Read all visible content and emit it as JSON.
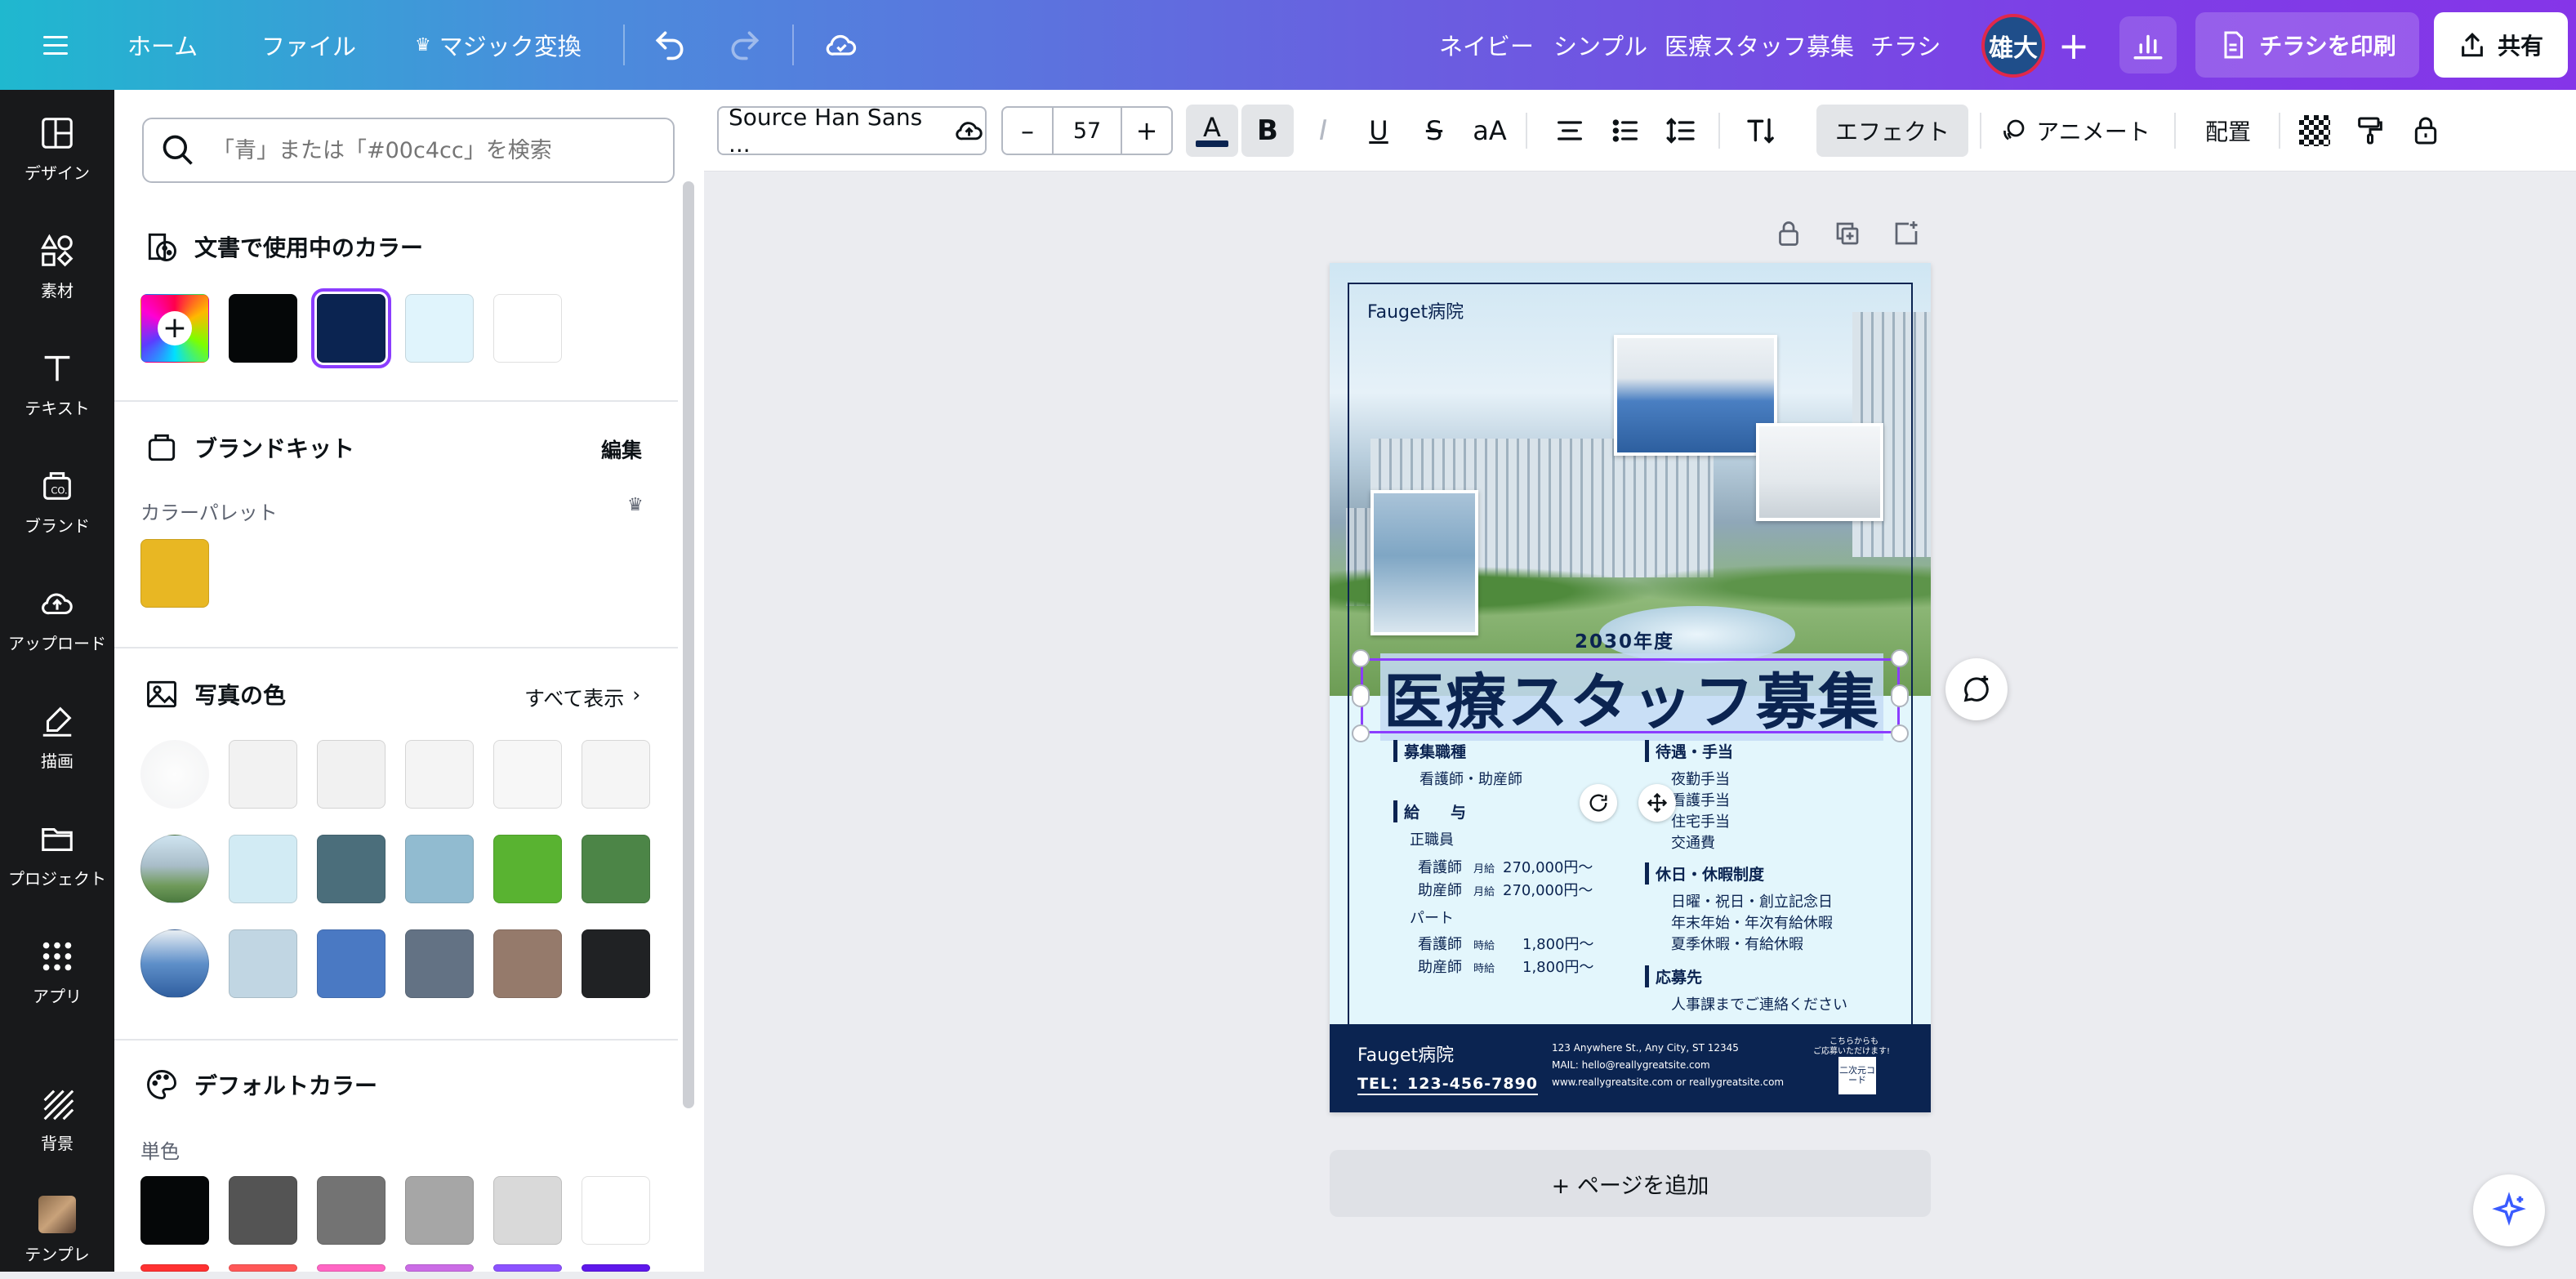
{
  "topbar": {
    "home": "ホーム",
    "file": "ファイル",
    "magic": "マジック変換",
    "tags": [
      "ネイビー",
      "シンプル",
      "医療スタッフ募集",
      "チラシ"
    ],
    "avatar": "雄大",
    "print": "チラシを印刷",
    "share": "共有"
  },
  "rail": [
    {
      "label": "デザイン",
      "icon": "design-icon"
    },
    {
      "label": "素材",
      "icon": "elements-icon"
    },
    {
      "label": "テキスト",
      "icon": "text-icon"
    },
    {
      "label": "ブランド",
      "icon": "brand-icon"
    },
    {
      "label": "アップロード",
      "icon": "upload-icon"
    },
    {
      "label": "描画",
      "icon": "draw-icon"
    },
    {
      "label": "プロジェクト",
      "icon": "folder-icon"
    },
    {
      "label": "アプリ",
      "icon": "apps-icon"
    },
    {
      "label": "背景",
      "icon": "background-icon"
    },
    {
      "label": "テンプレ",
      "icon": "template-icon"
    }
  ],
  "panel": {
    "search_placeholder": "「青」または「#00c4cc」を検索",
    "doc_colors_title": "文書で使用中のカラー",
    "doc_colors": [
      "#050708",
      "#0b2451",
      "#e0f4fc",
      "#ffffff"
    ],
    "brand_title": "ブランドキット",
    "brand_edit": "編集",
    "palette_label": "カラーパレット",
    "brand_colors": [
      "#e8b723"
    ],
    "photo_title": "写真の色",
    "show_all": "すべて表示",
    "photo_row1": [
      "#f7f7f7",
      "#f2f2f2",
      "#f1f1f1",
      "#f4f4f4",
      "#f7f7f7",
      "#f5f5f5"
    ],
    "photo_row2": [
      "#d2ebf4",
      "#4b6e7b",
      "#91bbd0",
      "#59b331",
      "#4c8547"
    ],
    "photo_row3": [
      "#c1d6e3",
      "#4a79c3",
      "#637284",
      "#957a6b",
      "#202224"
    ],
    "default_title": "デフォルトカラー",
    "solid_label": "単色",
    "default_row1": [
      "#050708",
      "#545454",
      "#737373",
      "#a6a6a6",
      "#d9d9d9",
      "#ffffff"
    ],
    "default_row2": [
      "#ff3131",
      "#ff5757",
      "#ff66c4",
      "#cb6ce6",
      "#8c52ff",
      "#5e17eb"
    ]
  },
  "toolbar": {
    "font": "Source Han Sans ...",
    "size": "57",
    "effects": "エフェクト",
    "animate": "アニメート",
    "position": "配置",
    "accent": "#8b3dff"
  },
  "flyer": {
    "hospital": "Fauget病院",
    "year": "2030年度",
    "headline": "医療スタッフ募集",
    "job_h": "募集職種",
    "job_v": "看護師・助産師",
    "salary_h": "給　　与",
    "fulltime": "正職員",
    "ft1_role": "看護師",
    "ft1_unit": "月給",
    "ft1_val": "270,000円〜",
    "ft2_role": "助産師",
    "ft2_unit": "月給",
    "ft2_val": "270,000円〜",
    "parttime": "パート",
    "pt1_role": "看護師",
    "pt1_unit": "時給",
    "pt1_val": "1,800円〜",
    "pt2_role": "助産師",
    "pt2_unit": "時給",
    "pt2_val": "1,800円〜",
    "benefit_h": "待遇・手当",
    "benefits": [
      "夜勤手当",
      "看護手当",
      "住宅手当",
      "交通費"
    ],
    "holiday_h": "休日・休暇制度",
    "holidays": [
      "日曜・祝日・創立記念日",
      "年末年始・年次有給休暇",
      "夏季休暇・有給休暇"
    ],
    "apply_h": "応募先",
    "apply_v": "人事課までご連絡ください",
    "footer_name": "Fauget病院",
    "tel": "TEL：123-456-7890",
    "address": "123 Anywhere St., Any City, ST 12345",
    "mail": "MAIL:  hello@reallygreatsite.com",
    "web": "www.reallygreatsite.com or reallygreatsite.com",
    "qr_note1": "こちらからも",
    "qr_note2": "ご応募いただけます!",
    "qr_label": "二次元コード",
    "navy": "#0b2451"
  },
  "canvas": {
    "add_page": "+ ページを追加"
  }
}
